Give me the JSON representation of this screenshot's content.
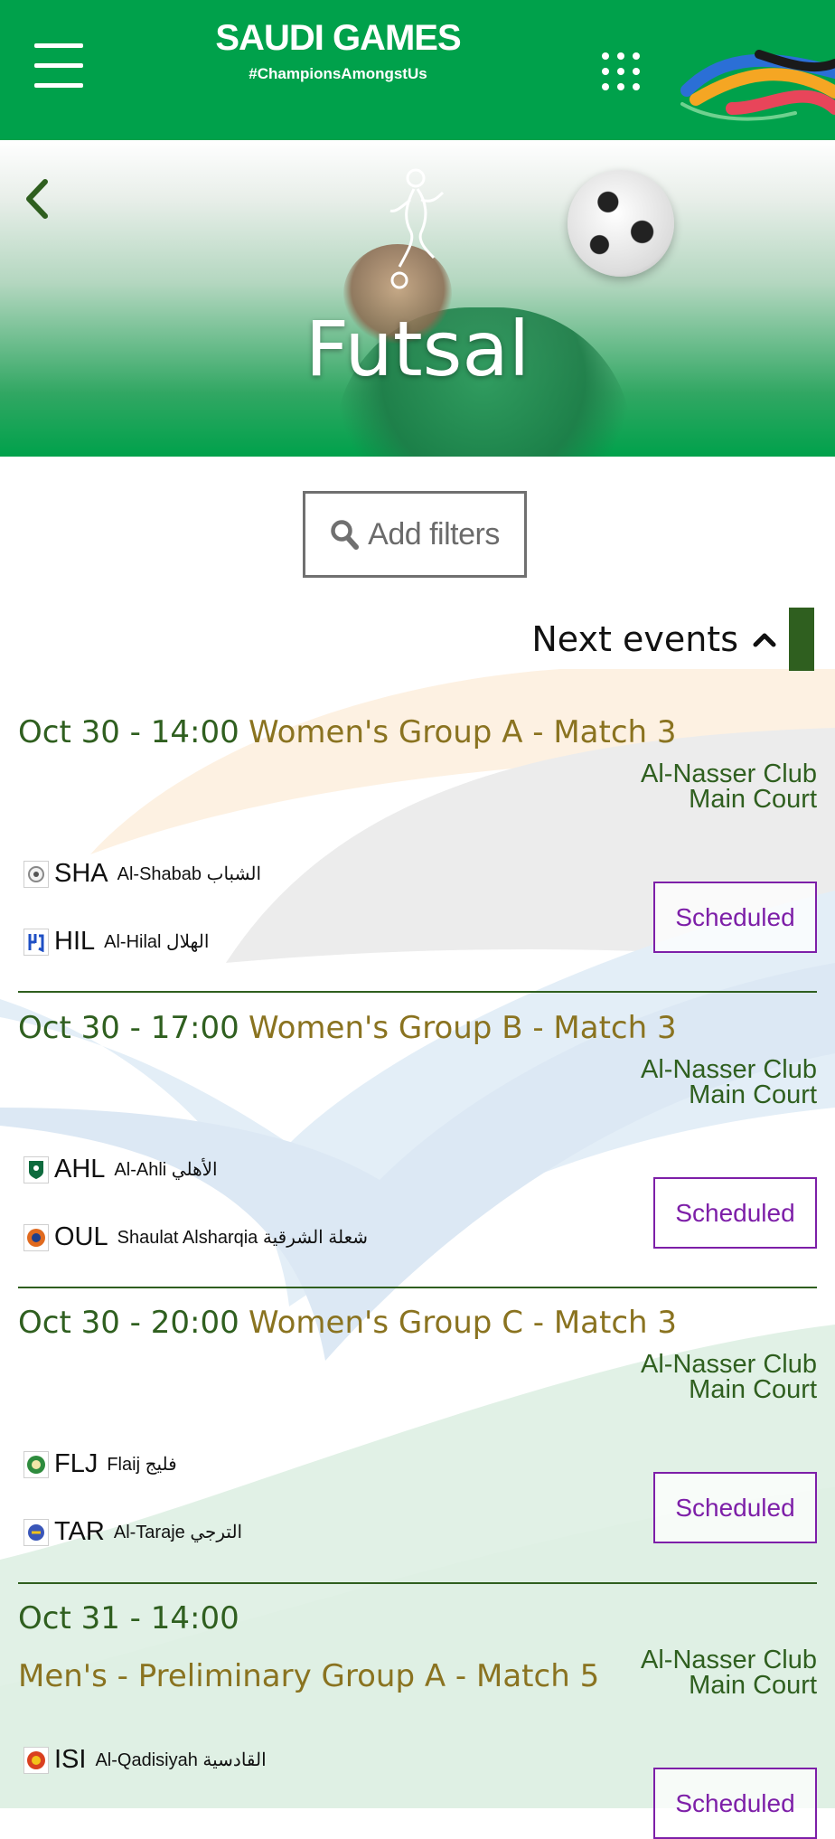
{
  "header": {
    "brand_name": "SAUDI GAMES",
    "hashtag": "#ChampionsAmongstUs",
    "menu_icon": "hamburger-menu-icon",
    "apps_icon": "dots-grid-icon",
    "accent": "#00a14b"
  },
  "hero": {
    "title": "Futsal",
    "back_icon": "chevron-left-icon",
    "sport_icon": "futsal-player-icon"
  },
  "filters": {
    "label": "Add filters",
    "icon": "search-icon"
  },
  "next_events": {
    "label": "Next events",
    "icon": "chevron-up-icon"
  },
  "events": [
    {
      "datetime": "Oct 30 - 14:00",
      "title": "Women's Group A - Match 3",
      "venue_line1": "Al-Nasser Club",
      "venue_line2": "Main Court",
      "status": "Scheduled",
      "teams": [
        {
          "code": "SHA",
          "name": "Al-Shabab الشباب",
          "crest_icon": "al-shabab-crest-icon"
        },
        {
          "code": "HIL",
          "name": "Al-Hilal الهلال",
          "crest_icon": "al-hilal-crest-icon"
        }
      ]
    },
    {
      "datetime": "Oct 30 - 17:00",
      "title": "Women's Group B - Match 3",
      "venue_line1": "Al-Nasser Club",
      "venue_line2": "Main Court",
      "status": "Scheduled",
      "teams": [
        {
          "code": "AHL",
          "name": "Al-Ahli الأهلي",
          "crest_icon": "al-ahli-crest-icon"
        },
        {
          "code": "OUL",
          "name": "Shaulat Alsharqia شعلة الشرقية",
          "crest_icon": "shaulat-alsharqia-crest-icon"
        }
      ]
    },
    {
      "datetime": "Oct 30 - 20:00",
      "title": "Women's Group C - Match 3",
      "venue_line1": "Al-Nasser Club",
      "venue_line2": "Main Court",
      "status": "Scheduled",
      "teams": [
        {
          "code": "FLJ",
          "name": "Flaij فليج",
          "crest_icon": "flaij-crest-icon"
        },
        {
          "code": "TAR",
          "name": "Al-Taraje الترجي",
          "crest_icon": "al-taraje-crest-icon"
        }
      ]
    },
    {
      "datetime": "Oct 31 - 14:00",
      "title": "Men's - Preliminary Group A - Match 5",
      "venue_line1": "Al-Nasser Club",
      "venue_line2": "Main Court",
      "status": "Scheduled",
      "teams": [
        {
          "code": "ISI",
          "name": "Al-Qadisiyah القادسية",
          "crest_icon": "al-qadisiyah-crest-icon"
        }
      ]
    }
  ],
  "colors": {
    "green_dark": "#2f5f1f",
    "gold": "#8a7320",
    "status_purple": "#7d1fa8"
  }
}
